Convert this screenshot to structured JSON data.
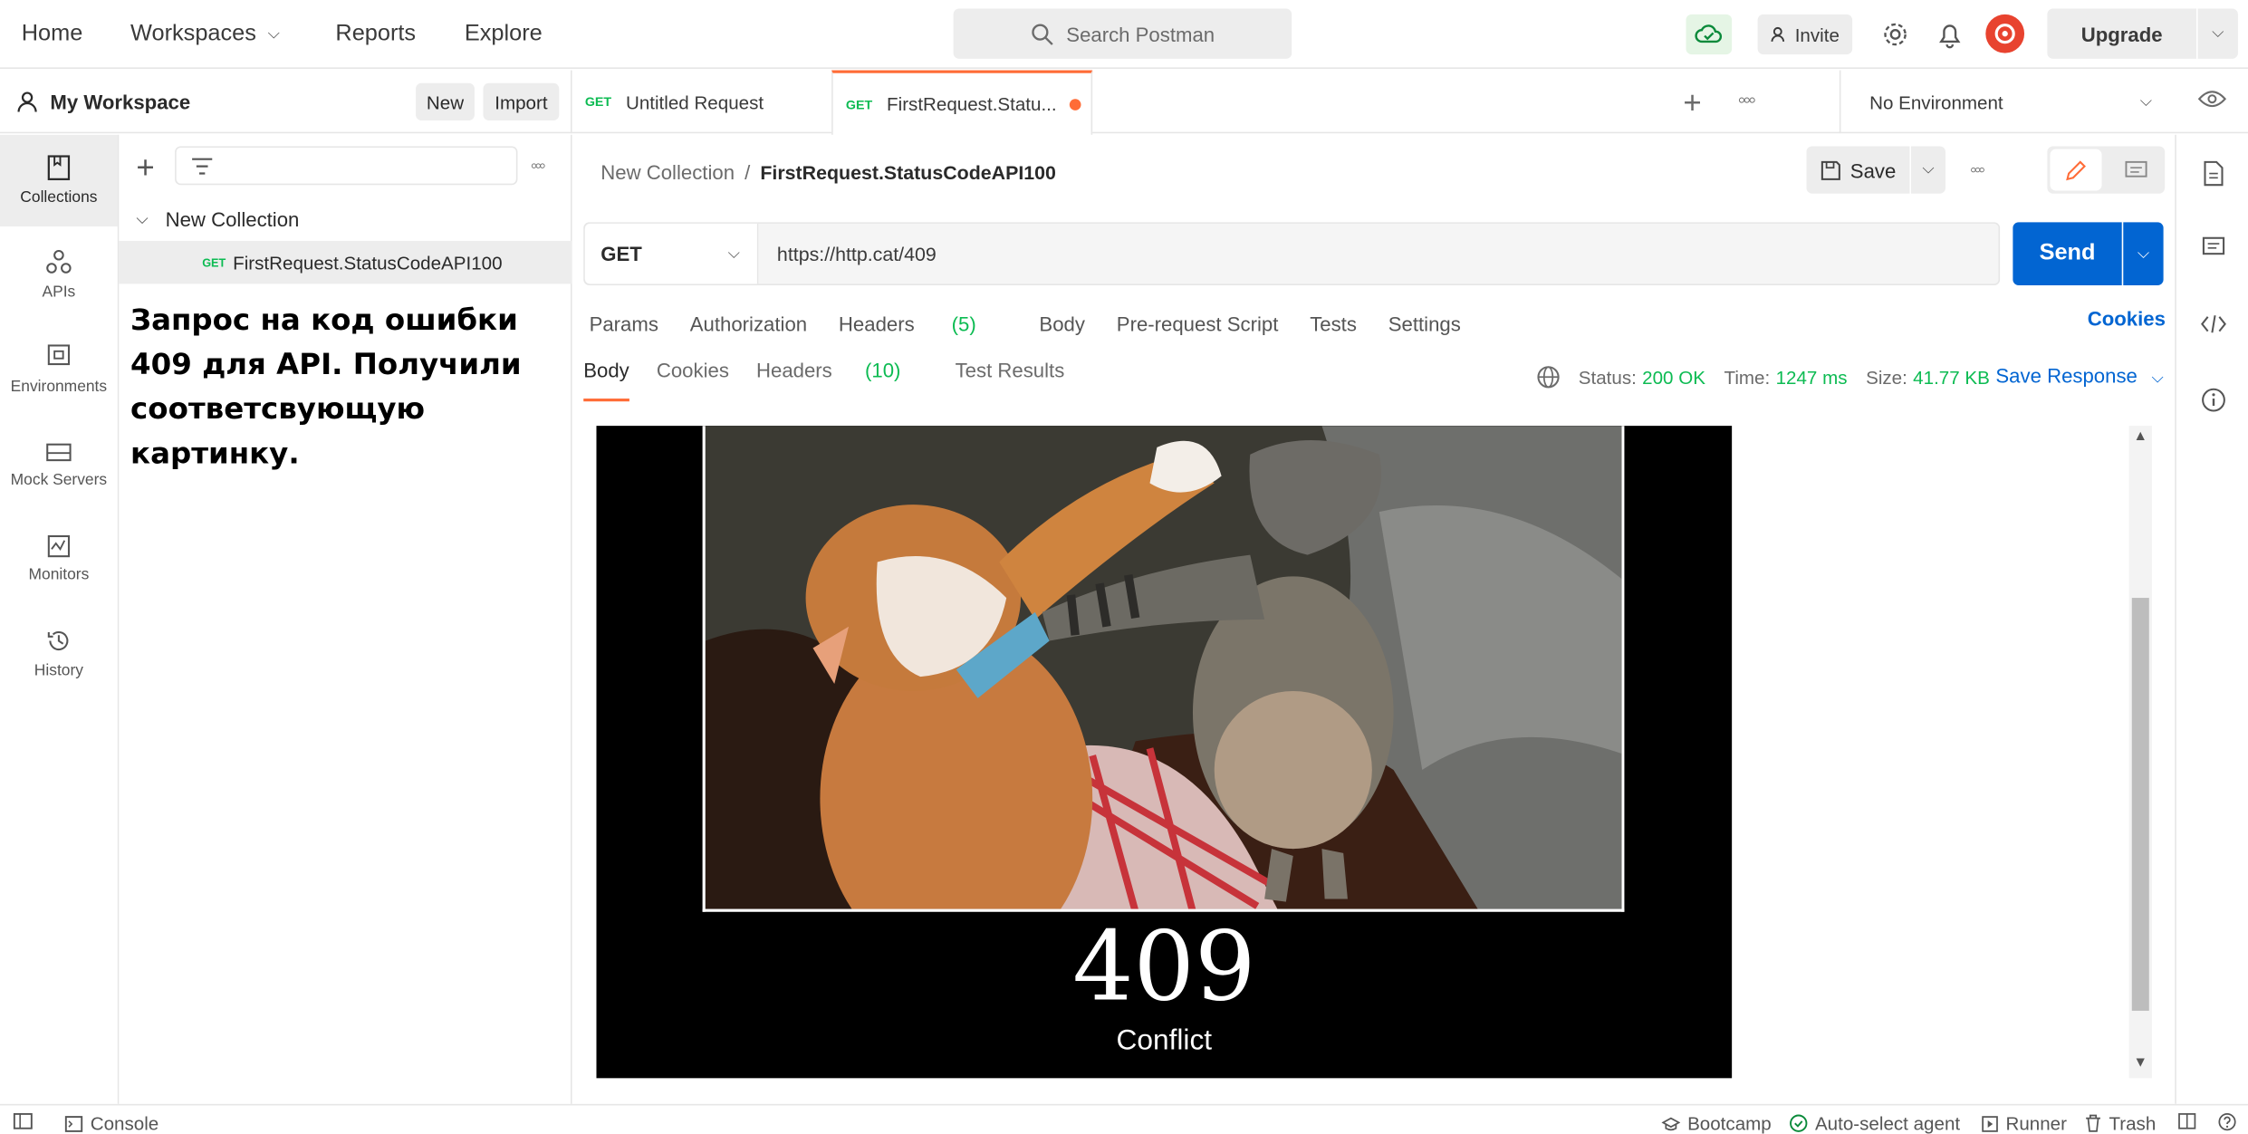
{
  "nav": {
    "home": "Home",
    "workspaces": "Workspaces",
    "reports": "Reports",
    "explore": "Explore"
  },
  "search": {
    "placeholder": "Search Postman"
  },
  "header": {
    "invite": "Invite",
    "upgrade": "Upgrade"
  },
  "workspace": {
    "name": "My Workspace",
    "new": "New",
    "import": "Import"
  },
  "tabs": [
    {
      "method": "GET",
      "label": "Untitled Request"
    },
    {
      "method": "GET",
      "label": "FirstRequest.Statu..."
    }
  ],
  "environment": "No Environment",
  "rail": [
    "Collections",
    "APIs",
    "Environments",
    "Mock Servers",
    "Monitors",
    "History"
  ],
  "sidebar": {
    "collection": "New Collection",
    "request_method": "GET",
    "request": "FirstRequest.StatusCodeAPI100",
    "note": "Запрос на код ошибки 409 для API. Получили соответсвующую картинку."
  },
  "breadcrumb": {
    "parent": "New Collection",
    "sep": "/",
    "current": "FirstRequest.StatusCodeAPI100"
  },
  "save": "Save",
  "request": {
    "method": "GET",
    "url": "https://http.cat/409",
    "send": "Send"
  },
  "request_tabs": {
    "params": "Params",
    "authorization": "Authorization",
    "headers": "Headers",
    "headers_count": "(5)",
    "body": "Body",
    "prerequest": "Pre-request Script",
    "tests": "Tests",
    "settings": "Settings",
    "cookies": "Cookies"
  },
  "response_tabs": {
    "body": "Body",
    "cookies": "Cookies",
    "headers": "Headers",
    "headers_count": "(10)",
    "tests": "Test Results"
  },
  "response": {
    "status_label": "Status:",
    "status": "200 OK",
    "time_label": "Time:",
    "time": "1247 ms",
    "size_label": "Size:",
    "size": "41.77 KB",
    "save_response": "Save Response",
    "image_code": "409",
    "image_caption": "Conflict"
  },
  "footer": {
    "console": "Console",
    "bootcamp": "Bootcamp",
    "agent": "Auto-select agent",
    "runner": "Runner",
    "trash": "Trash"
  },
  "colors": {
    "accent": "#ff6c37",
    "primary": "#0265d2",
    "success": "#0cbb52"
  }
}
